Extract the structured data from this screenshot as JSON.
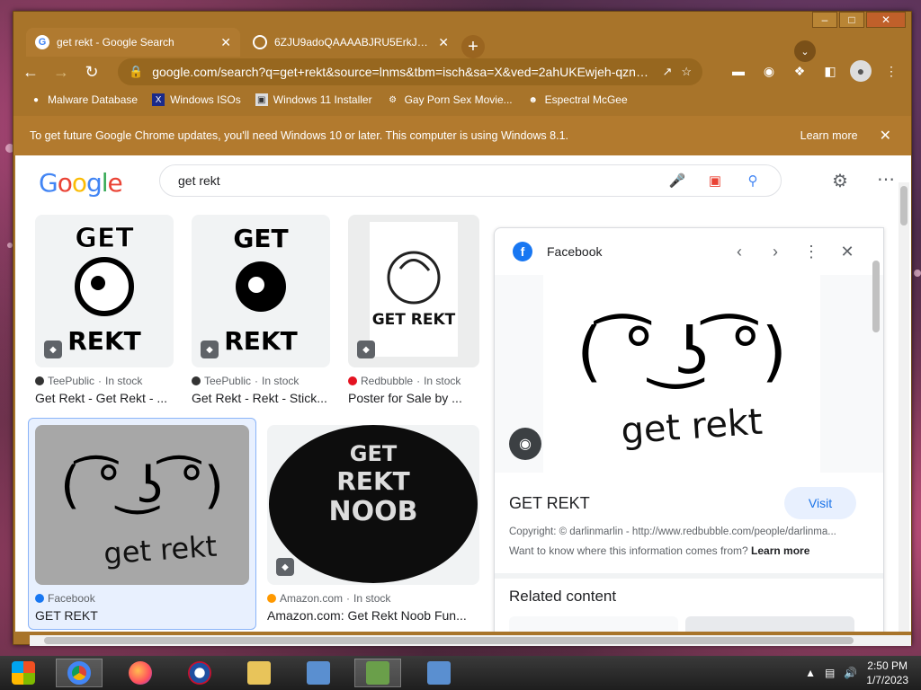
{
  "browser": {
    "tabs": [
      {
        "title": "get rekt - Google Search",
        "active": true
      },
      {
        "title": "6ZJU9adoQAAAABJRU5ErkJggg",
        "active": false
      }
    ],
    "url": "google.com/search?q=get+rekt&source=lnms&tbm=isch&sa=X&ved=2ahUKEwjeh-qznbb8...",
    "bookmarks": [
      {
        "label": "Malware Database"
      },
      {
        "label": "Windows ISOs"
      },
      {
        "label": "Windows 11 Installer"
      },
      {
        "label": "Gay Porn Sex Movie..."
      },
      {
        "label": "Espectral McGee"
      }
    ],
    "infobar": {
      "message": "To get future Google Chrome updates, you'll need Windows 10 or later. This computer is using Windows 8.1.",
      "learn_more": "Learn more"
    }
  },
  "google": {
    "logo": "Google",
    "query": "get rekt",
    "results": [
      {
        "source": "TeePublic",
        "stock": "In stock",
        "title": "Get Rekt - Get Rekt - ..."
      },
      {
        "source": "TeePublic",
        "stock": "In stock",
        "title": "Get Rekt - Rekt - Stick..."
      },
      {
        "source": "Redbubble",
        "stock": "In stock",
        "title": "Poster for Sale by ..."
      },
      {
        "source": "Facebook",
        "stock": "",
        "title": "GET REKT"
      },
      {
        "source": "Amazon.com",
        "stock": "In stock",
        "title": "Amazon.com: Get Rekt Noob Fun..."
      }
    ],
    "stock_sep": " · ",
    "thumb_text": {
      "get": "GET",
      "rekt": "REKT",
      "noob": "NOOB",
      "get_rekt_lower": "get rekt",
      "get_rekt_caps": "GET REKT",
      "lenny": "( ͡° ͜ʖ ͡°)"
    }
  },
  "panel": {
    "site": "Facebook",
    "title": "GET REKT",
    "visit": "Visit",
    "copyright": "Copyright: © darlinmarlin - http://www.redbubble.com/people/darlinma...",
    "want_to_know": "Want to know where this information comes from?",
    "learn_more": "Learn more",
    "related": "Related content"
  },
  "taskbar": {
    "time": "2:50 PM",
    "date": "1/7/2023"
  }
}
